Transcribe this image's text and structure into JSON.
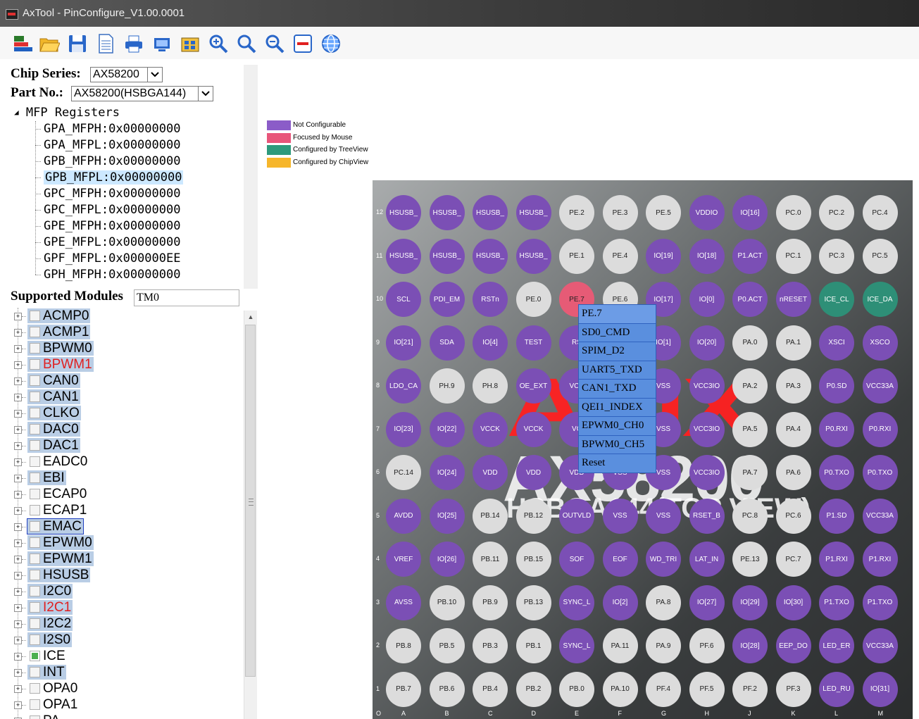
{
  "window": {
    "title": "AxTool - PinConfigure_V1.00.0001"
  },
  "toolbar": {
    "buttons": [
      {
        "name": "pin-config-icon"
      },
      {
        "name": "open-folder-icon"
      },
      {
        "name": "save-icon"
      },
      {
        "name": "document-icon"
      },
      {
        "name": "print-icon"
      },
      {
        "name": "monitor-icon"
      },
      {
        "name": "chip-icon"
      },
      {
        "name": "zoom-in-icon"
      },
      {
        "name": "zoom-icon"
      },
      {
        "name": "zoom-out-icon"
      },
      {
        "name": "minus-icon"
      },
      {
        "name": "globe-icon"
      }
    ]
  },
  "left": {
    "chip_series_label": "Chip Series:",
    "chip_series_value": "AX58200",
    "part_no_label": "Part No.:",
    "part_no_value": "AX58200(HSBGA144)",
    "mfp_root": "MFP Registers",
    "registers": [
      "GPA_MFPH:0x00000000",
      "GPA_MFPL:0x00000000",
      "GPB_MFPH:0x00000000",
      "GPB_MFPL:0x00000000",
      "GPC_MFPH:0x00000000",
      "GPC_MFPL:0x00000000",
      "GPE_MFPH:0x00000000",
      "GPE_MFPL:0x00000000",
      "GPF_MFPL:0x000000EE",
      "GPH_MFPH:0x00000000"
    ],
    "selected_register_index": 3,
    "supported_modules_label": "Supported Modules",
    "module_filter_value": "TM0",
    "modules": [
      {
        "name": "ACMP0"
      },
      {
        "name": "ACMP1"
      },
      {
        "name": "BPWM0"
      },
      {
        "name": "BPWM1",
        "state": "red"
      },
      {
        "name": "CAN0"
      },
      {
        "name": "CAN1"
      },
      {
        "name": "CLKO"
      },
      {
        "name": "DAC0"
      },
      {
        "name": "DAC1"
      },
      {
        "name": "EADC0",
        "state": "plain"
      },
      {
        "name": "EBI"
      },
      {
        "name": "ECAP0",
        "state": "plain"
      },
      {
        "name": "ECAP1",
        "state": "plain"
      },
      {
        "name": "EMAC",
        "state": "outline"
      },
      {
        "name": "EPWM0"
      },
      {
        "name": "EPWM1"
      },
      {
        "name": "HSUSB"
      },
      {
        "name": "I2C0"
      },
      {
        "name": "I2C1",
        "state": "red"
      },
      {
        "name": "I2C2"
      },
      {
        "name": "I2S0"
      },
      {
        "name": "ICE",
        "checked": true,
        "state": "plain"
      },
      {
        "name": "INT"
      },
      {
        "name": "OPA0",
        "state": "plain"
      },
      {
        "name": "OPA1",
        "state": "plain"
      },
      {
        "name": "PA",
        "state": "plain"
      }
    ]
  },
  "legend": [
    {
      "label": "Not Configurable",
      "color": "#8b5cc8"
    },
    {
      "label": "Focused by Mouse",
      "color": "#e8557a"
    },
    {
      "label": "Configured by TreeView",
      "color": "#2e9a7c"
    },
    {
      "label": "Configured by ChipView",
      "color": "#f6b62b"
    }
  ],
  "chip": {
    "watermark_brand": "ASIX",
    "watermark_model": "AX58200",
    "watermark_package": "HSBGA144(TOP VIEW)",
    "columns": [
      "A",
      "B",
      "C",
      "D",
      "E",
      "F",
      "G",
      "H",
      "J",
      "K",
      "L",
      "M"
    ],
    "corner_label": "O",
    "rows": [
      {
        "row": "12",
        "pins": [
          [
            "HSUSB_",
            "nc"
          ],
          [
            "HSUSB_",
            "nc"
          ],
          [
            "HSUSB_",
            "nc"
          ],
          [
            "HSUSB_",
            "nc"
          ],
          [
            "PE.2",
            "cf"
          ],
          [
            "PE.3",
            "cf"
          ],
          [
            "PE.5",
            "cf"
          ],
          [
            "VDDIO",
            "nc"
          ],
          [
            "IO[16]",
            "nc"
          ],
          [
            "PC.0",
            "cf"
          ],
          [
            "PC.2",
            "cf"
          ],
          [
            "PC.4",
            "cf"
          ]
        ]
      },
      {
        "row": "11",
        "pins": [
          [
            "HSUSB_",
            "nc"
          ],
          [
            "HSUSB_",
            "nc"
          ],
          [
            "HSUSB_",
            "nc"
          ],
          [
            "HSUSB_",
            "nc"
          ],
          [
            "PE.1",
            "cf"
          ],
          [
            "PE.4",
            "cf"
          ],
          [
            "IO[19]",
            "nc"
          ],
          [
            "IO[18]",
            "nc"
          ],
          [
            "P1.ACT",
            "nc"
          ],
          [
            "PC.1",
            "cf"
          ],
          [
            "PC.3",
            "cf"
          ],
          [
            "PC.5",
            "cf"
          ]
        ]
      },
      {
        "row": "10",
        "pins": [
          [
            "SCL",
            "nc"
          ],
          [
            "PDI_EM",
            "nc"
          ],
          [
            "RSTn",
            "nc"
          ],
          [
            "PE.0",
            "cf"
          ],
          [
            "PE.7",
            "focus"
          ],
          [
            "PE.6",
            "cf"
          ],
          [
            "IO[17]",
            "nc"
          ],
          [
            "IO[0]",
            "nc"
          ],
          [
            "P0.ACT",
            "nc"
          ],
          [
            "nRESET",
            "nc"
          ],
          [
            "ICE_CL",
            "tree"
          ],
          [
            "ICE_DA",
            "tree"
          ]
        ]
      },
      {
        "row": "9",
        "pins": [
          [
            "IO[21]",
            "nc"
          ],
          [
            "SDA",
            "nc"
          ],
          [
            "IO[4]",
            "nc"
          ],
          [
            "TEST",
            "nc"
          ],
          [
            "RS",
            "nc"
          ],
          [
            "",
            "nc"
          ],
          [
            "IO[1]",
            "nc"
          ],
          [
            "IO[20]",
            "nc"
          ],
          [
            "PA.0",
            "cf"
          ],
          [
            "PA.1",
            "cf"
          ],
          [
            "XSCI",
            "nc"
          ],
          [
            "XSCO",
            "nc"
          ]
        ]
      },
      {
        "row": "8",
        "pins": [
          [
            "LDO_CA",
            "nc"
          ],
          [
            "PH.9",
            "cf"
          ],
          [
            "PH.8",
            "cf"
          ],
          [
            "OE_EXT",
            "nc"
          ],
          [
            "VCC",
            "nc"
          ],
          [
            "",
            "nc"
          ],
          [
            "VSS",
            "nc"
          ],
          [
            "VCC3IO",
            "nc"
          ],
          [
            "PA.2",
            "cf"
          ],
          [
            "PA.3",
            "cf"
          ],
          [
            "P0.SD",
            "nc"
          ],
          [
            "VCC33A",
            "nc"
          ]
        ]
      },
      {
        "row": "7",
        "pins": [
          [
            "IO[23]",
            "nc"
          ],
          [
            "IO[22]",
            "nc"
          ],
          [
            "VCCK",
            "nc"
          ],
          [
            "VCCK",
            "nc"
          ],
          [
            "VC",
            "nc"
          ],
          [
            "",
            "nc"
          ],
          [
            "VSS",
            "nc"
          ],
          [
            "VCC3IO",
            "nc"
          ],
          [
            "PA.5",
            "cf"
          ],
          [
            "PA.4",
            "cf"
          ],
          [
            "P0.RXI",
            "nc"
          ],
          [
            "P0.RXI",
            "nc"
          ]
        ]
      },
      {
        "row": "6",
        "pins": [
          [
            "PC.14",
            "cf"
          ],
          [
            "IO[24]",
            "nc"
          ],
          [
            "VDD",
            "nc"
          ],
          [
            "VDD",
            "nc"
          ],
          [
            "VDD",
            "nc"
          ],
          [
            "VSS",
            "nc"
          ],
          [
            "VSS",
            "nc"
          ],
          [
            "VCC3IO",
            "nc"
          ],
          [
            "PA.7",
            "cf"
          ],
          [
            "PA.6",
            "cf"
          ],
          [
            "P0.TXO",
            "nc"
          ],
          [
            "P0.TXO",
            "nc"
          ]
        ]
      },
      {
        "row": "5",
        "pins": [
          [
            "AVDD",
            "nc"
          ],
          [
            "IO[25]",
            "nc"
          ],
          [
            "PB.14",
            "cf"
          ],
          [
            "PB.12",
            "cf"
          ],
          [
            "OUTVLD",
            "nc"
          ],
          [
            "VSS",
            "nc"
          ],
          [
            "VSS",
            "nc"
          ],
          [
            "RSET_B",
            "nc"
          ],
          [
            "PC.8",
            "cf"
          ],
          [
            "PC.6",
            "cf"
          ],
          [
            "P1.SD",
            "nc"
          ],
          [
            "VCC33A",
            "nc"
          ]
        ]
      },
      {
        "row": "4",
        "pins": [
          [
            "VREF",
            "nc"
          ],
          [
            "IO[26]",
            "nc"
          ],
          [
            "PB.11",
            "cf"
          ],
          [
            "PB.15",
            "cf"
          ],
          [
            "SOF",
            "nc"
          ],
          [
            "EOF",
            "nc"
          ],
          [
            "WD_TRI",
            "nc"
          ],
          [
            "LAT_IN",
            "nc"
          ],
          [
            "PE.13",
            "cf"
          ],
          [
            "PC.7",
            "cf"
          ],
          [
            "P1.RXI",
            "nc"
          ],
          [
            "P1.RXI",
            "nc"
          ]
        ]
      },
      {
        "row": "3",
        "pins": [
          [
            "AVSS",
            "nc"
          ],
          [
            "PB.10",
            "cf"
          ],
          [
            "PB.9",
            "cf"
          ],
          [
            "PB.13",
            "cf"
          ],
          [
            "SYNC_L",
            "nc"
          ],
          [
            "IO[2]",
            "nc"
          ],
          [
            "PA.8",
            "cf"
          ],
          [
            "IO[27]",
            "nc"
          ],
          [
            "IO[29]",
            "nc"
          ],
          [
            "IO[30]",
            "nc"
          ],
          [
            "P1.TXO",
            "nc"
          ],
          [
            "P1.TXO",
            "nc"
          ]
        ]
      },
      {
        "row": "2",
        "pins": [
          [
            "PB.8",
            "cf"
          ],
          [
            "PB.5",
            "cf"
          ],
          [
            "PB.3",
            "cf"
          ],
          [
            "PB.1",
            "cf"
          ],
          [
            "SYNC_L",
            "nc"
          ],
          [
            "PA.11",
            "cf"
          ],
          [
            "PA.9",
            "cf"
          ],
          [
            "PF.6",
            "cf"
          ],
          [
            "IO[28]",
            "nc"
          ],
          [
            "EEP_DO",
            "nc"
          ],
          [
            "LED_ER",
            "nc"
          ],
          [
            "VCC33A",
            "nc"
          ]
        ]
      },
      {
        "row": "1",
        "pins": [
          [
            "PB.7",
            "cf"
          ],
          [
            "PB.6",
            "cf"
          ],
          [
            "PB.4",
            "cf"
          ],
          [
            "PB.2",
            "cf"
          ],
          [
            "PB.0",
            "cf"
          ],
          [
            "PA.10",
            "cf"
          ],
          [
            "PF.4",
            "cf"
          ],
          [
            "PF.5",
            "cf"
          ],
          [
            "PF.2",
            "cf"
          ],
          [
            "PF.3",
            "cf"
          ],
          [
            "LED_RU",
            "nc"
          ],
          [
            "IO[31]",
            "nc"
          ]
        ]
      }
    ]
  },
  "popup_menu": {
    "items": [
      "PE.7",
      "SD0_CMD",
      "SPIM_D2",
      "UART5_TXD",
      "CAN1_TXD",
      "QEI1_INDEX",
      "EPWM0_CH0",
      "BPWM0_CH5",
      "Reset"
    ]
  }
}
